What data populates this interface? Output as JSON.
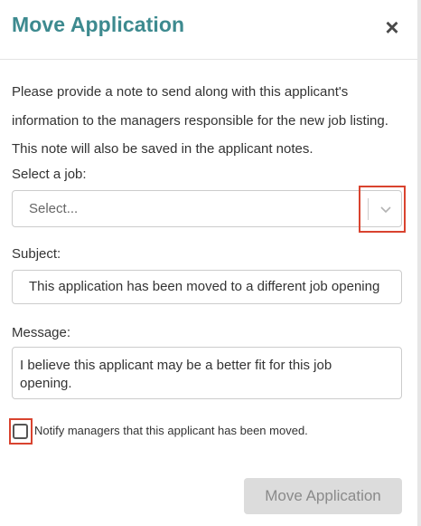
{
  "modal": {
    "title": "Move Application",
    "close_label": "×",
    "description": "Please provide a note to send along with this applicant's information to the managers responsible for the new job listing. This note will also be saved in the applicant notes."
  },
  "job": {
    "label": "Select a job:",
    "placeholder": "Select..."
  },
  "subject": {
    "label": "Subject:",
    "value": "This application has been moved to a different job opening"
  },
  "message": {
    "label": "Message:",
    "value": "I believe this applicant may be a better fit for this job opening."
  },
  "notify": {
    "label": "Notify managers that this applicant has been moved.",
    "checked": false
  },
  "actions": {
    "submit_label": "Move Application"
  },
  "colors": {
    "title": "#3d8a8f",
    "highlight": "#d9432f",
    "button_disabled": "#dcdcdc"
  }
}
